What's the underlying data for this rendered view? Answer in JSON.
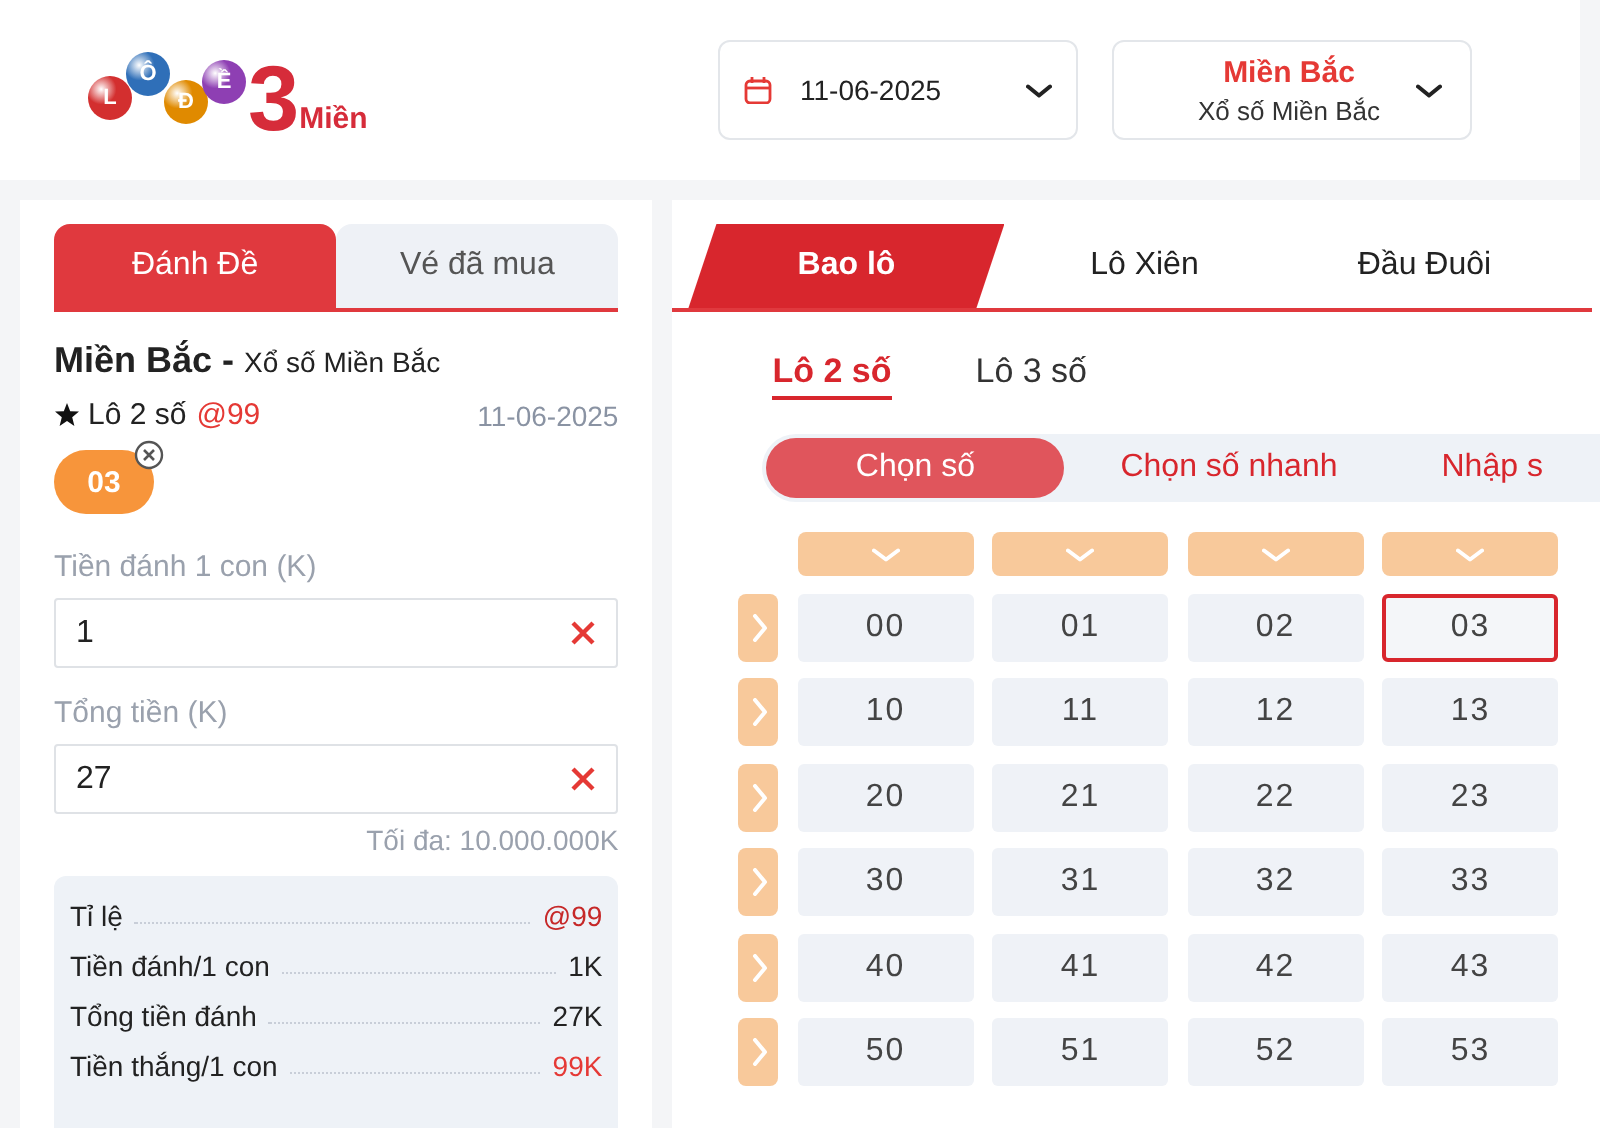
{
  "header": {
    "logo": {
      "balls": [
        "L",
        "Ô",
        "Đ",
        "Ề"
      ],
      "number": "3",
      "word": "Miền"
    },
    "date_picker": {
      "value": "11-06-2025"
    },
    "region_picker": {
      "title": "Miền Bắc",
      "subtitle": "Xổ số Miền Bắc"
    }
  },
  "left_panel": {
    "tabs": [
      {
        "label": "Đánh Đề",
        "selected": true
      },
      {
        "label": "Vé đã mua",
        "selected": false
      }
    ],
    "region": "Miền Bắc -",
    "lottery": "Xổ số Miền Bắc",
    "bet_type": "Lô 2 số",
    "odds": "@99",
    "date": "11-06-2025",
    "chips": [
      {
        "number": "03"
      }
    ],
    "fields": [
      {
        "label": "Tiền đánh 1 con (K)",
        "value": "1"
      },
      {
        "label": "Tổng tiền (K)",
        "value": "27"
      }
    ],
    "max_note": "Tối đa: 10.000.000K",
    "summary": [
      {
        "label": "Tỉ lệ",
        "value": "@99",
        "color": "#c62828"
      },
      {
        "label": "Tiền đánh/1 con",
        "value": "1K",
        "color": "#222222"
      },
      {
        "label": "Tổng tiền đánh",
        "value": "27K",
        "color": "#222222"
      },
      {
        "label": "Tiền thắng/1 con",
        "value": "99K",
        "color": "#e53935"
      }
    ]
  },
  "right_panel": {
    "game_tabs": [
      {
        "label": "Bao lô",
        "selected": true
      },
      {
        "label": "Lô Xiên",
        "selected": false
      },
      {
        "label": "Đầu Đuôi",
        "selected": false
      }
    ],
    "number_tabs": [
      {
        "label": "Lô 2 số",
        "selected": true
      },
      {
        "label": "Lô 3 số",
        "selected": false
      }
    ],
    "mode_tabs": [
      {
        "label": "Chọn số",
        "selected": true
      },
      {
        "label": "Chọn số nhanh",
        "selected": false
      },
      {
        "label": "Nhập s",
        "selected": false
      }
    ],
    "grid": {
      "rows": [
        {
          "cells": [
            {
              "number": "00",
              "selected": false
            },
            {
              "number": "01",
              "selected": false
            },
            {
              "number": "02",
              "selected": false
            },
            {
              "number": "03",
              "selected": true
            }
          ]
        },
        {
          "cells": [
            {
              "number": "10",
              "selected": false
            },
            {
              "number": "11",
              "selected": false
            },
            {
              "number": "12",
              "selected": false
            },
            {
              "number": "13",
              "selected": false
            }
          ]
        },
        {
          "cells": [
            {
              "number": "20",
              "selected": false
            },
            {
              "number": "21",
              "selected": false
            },
            {
              "number": "22",
              "selected": false
            },
            {
              "number": "23",
              "selected": false
            }
          ]
        },
        {
          "cells": [
            {
              "number": "30",
              "selected": false
            },
            {
              "number": "31",
              "selected": false
            },
            {
              "number": "32",
              "selected": false
            },
            {
              "number": "33",
              "selected": false
            }
          ]
        },
        {
          "cells": [
            {
              "number": "40",
              "selected": false
            },
            {
              "number": "41",
              "selected": false
            },
            {
              "number": "42",
              "selected": false
            },
            {
              "number": "43",
              "selected": false
            }
          ]
        },
        {
          "cells": [
            {
              "number": "50",
              "selected": false
            },
            {
              "number": "51",
              "selected": false
            },
            {
              "number": "52",
              "selected": false
            },
            {
              "number": "53",
              "selected": false
            }
          ]
        }
      ]
    }
  }
}
